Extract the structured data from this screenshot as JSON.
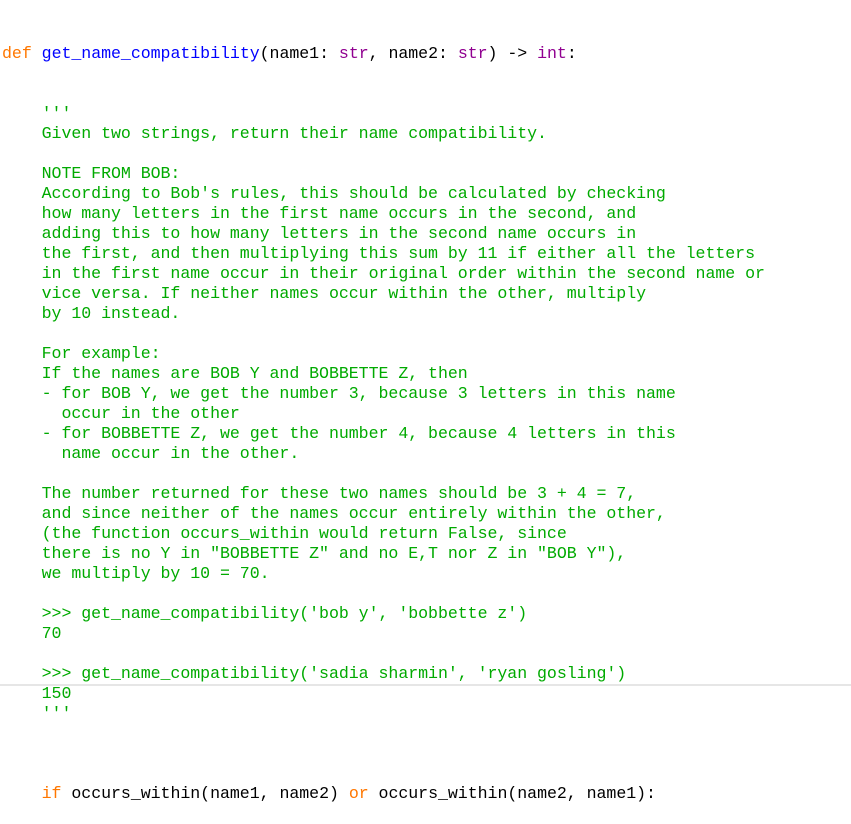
{
  "editor": {
    "signature": {
      "keyword": "def",
      "function_name": "get_name_compatibility",
      "params_open": "(name1: ",
      "type1": "str",
      "params_mid": ", name2: ",
      "type2": "str",
      "arrow": ") -> ",
      "return_type": "int",
      "colon": ":"
    },
    "docstring_lines": [
      "    '''",
      "    Given two strings, return their name compatibility.",
      "",
      "    NOTE FROM BOB:",
      "    According to Bob's rules, this should be calculated by checking",
      "    how many letters in the first name occurs in the second, and",
      "    adding this to how many letters in the second name occurs in",
      "    the first, and then multiplying this sum by 11 if either all the letters",
      "    in the first name occur in their original order within the second name or",
      "    vice versa. If neither names occur within the other, multiply",
      "    by 10 instead.",
      "",
      "    For example:",
      "    If the names are BOB Y and BOBBETTE Z, then",
      "    - for BOB Y, we get the number 3, because 3 letters in this name",
      "      occur in the other",
      "    - for BOBBETTE Z, we get the number 4, because 4 letters in this",
      "      name occur in the other.",
      "",
      "    The number returned for these two names should be 3 + 4 = 7,",
      "    and since neither of the names occur entirely within the other,",
      "    (the function occurs_within would return False, since",
      "    there is no Y in \"BOBBETTE Z\" and no E,T nor Z in \"BOB Y\"),",
      "    we multiply by 10 = 70.",
      "",
      "    >>> get_name_compatibility('bob y', 'bobbette z')",
      "    70",
      "",
      "    >>> get_name_compatibility('sadia sharmin', 'ryan gosling')",
      "    150",
      "    '''",
      ""
    ],
    "last_line": {
      "indent": "    ",
      "keyword_if": "if",
      "part1": " occurs_within(name1, name2) ",
      "keyword_or": "or",
      "part2": " occurs_within(name2, name1):"
    }
  },
  "colors": {
    "keyword": "#ff7700",
    "function_name": "#0000ff",
    "builtin": "#900090",
    "string": "#00aa00",
    "default": "#000000"
  }
}
